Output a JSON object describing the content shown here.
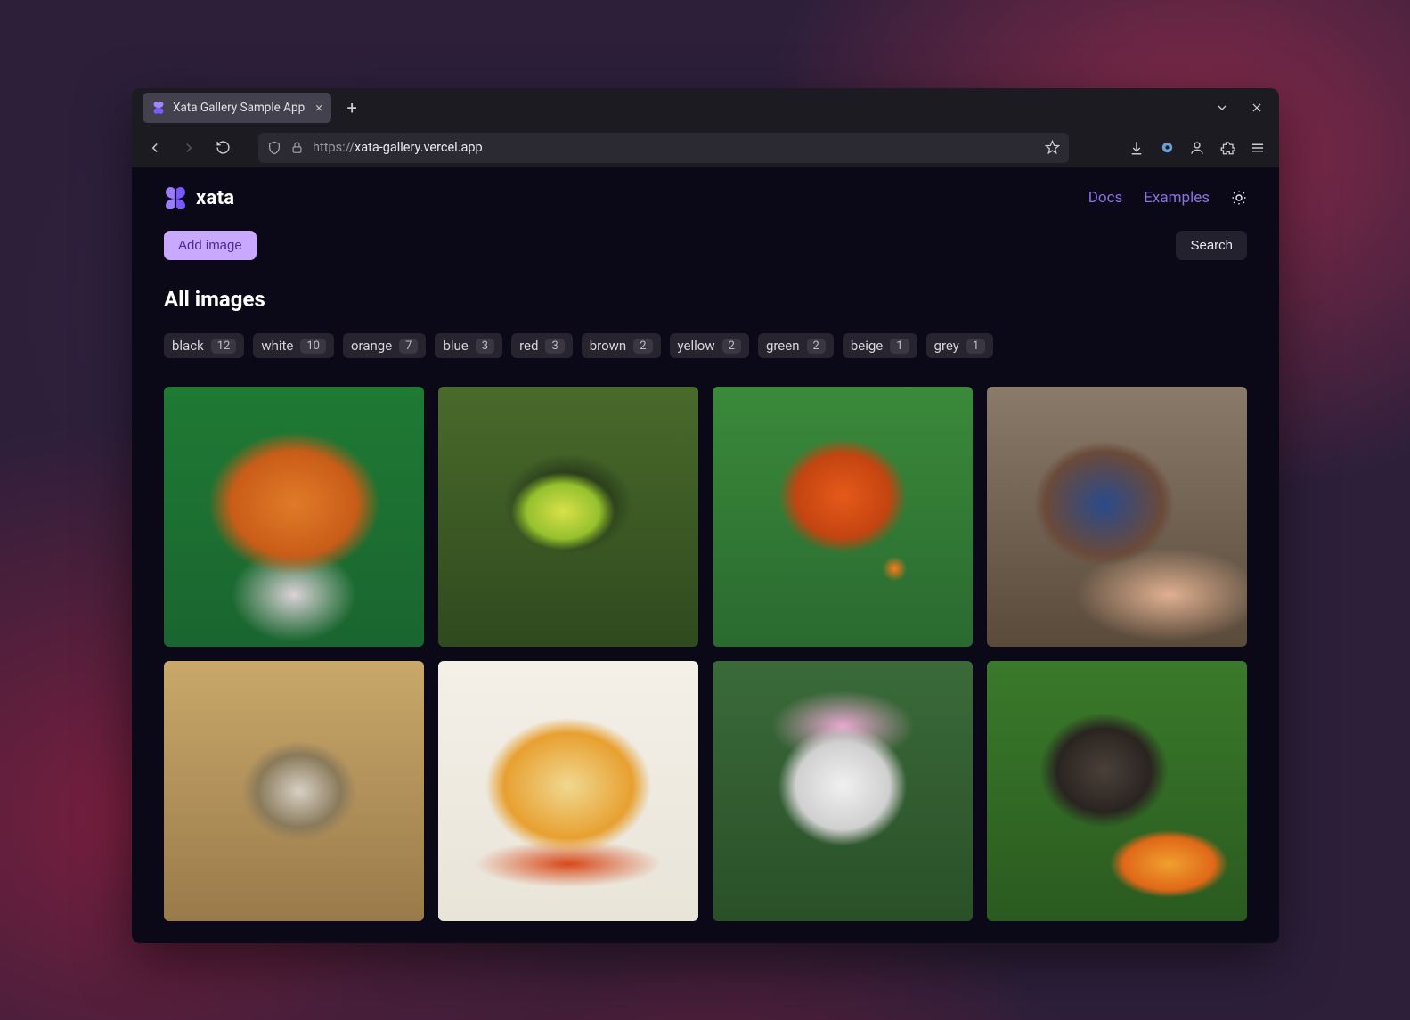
{
  "browser": {
    "tab_title": "Xata Gallery Sample App",
    "url_protocol": "https://",
    "url_host_path": "xata-gallery.vercel.app"
  },
  "app": {
    "brand": "xata",
    "nav": {
      "docs": "Docs",
      "examples": "Examples"
    },
    "add_button": "Add image",
    "search_button": "Search",
    "page_title": "All images",
    "tags": [
      {
        "label": "black",
        "count": "12"
      },
      {
        "label": "white",
        "count": "10"
      },
      {
        "label": "orange",
        "count": "7"
      },
      {
        "label": "blue",
        "count": "3"
      },
      {
        "label": "red",
        "count": "3"
      },
      {
        "label": "brown",
        "count": "2"
      },
      {
        "label": "yellow",
        "count": "2"
      },
      {
        "label": "green",
        "count": "2"
      },
      {
        "label": "beige",
        "count": "1"
      },
      {
        "label": "grey",
        "count": "1"
      }
    ]
  }
}
